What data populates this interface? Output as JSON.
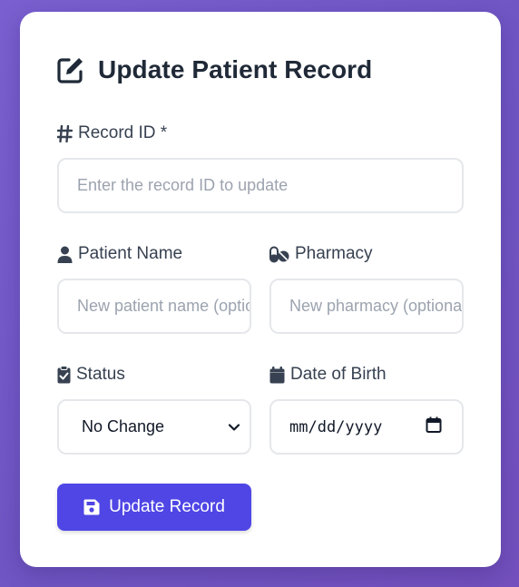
{
  "form": {
    "title": "Update Patient Record",
    "record_id": {
      "label": "Record ID *",
      "placeholder": "Enter the record ID to update"
    },
    "patient_name": {
      "label": "Patient Name",
      "placeholder": "New patient name (optional)"
    },
    "pharmacy": {
      "label": "Pharmacy",
      "placeholder": "New pharmacy (optional)"
    },
    "status": {
      "label": "Status",
      "selected": "No Change"
    },
    "date_of_birth": {
      "label": "Date of Birth",
      "value": "mm/dd/yyyy"
    },
    "submit_label": "Update Record"
  },
  "colors": {
    "accent": "#4f46e5",
    "background_gradient": "#7a5fd0",
    "text_dark": "#1f2937"
  },
  "icons": {
    "title": "edit-icon",
    "record_id": "hash-icon",
    "patient_name": "user-icon",
    "pharmacy": "pills-icon",
    "status": "clipboard-check-icon",
    "date_of_birth": "calendar-icon",
    "submit": "save-icon"
  }
}
